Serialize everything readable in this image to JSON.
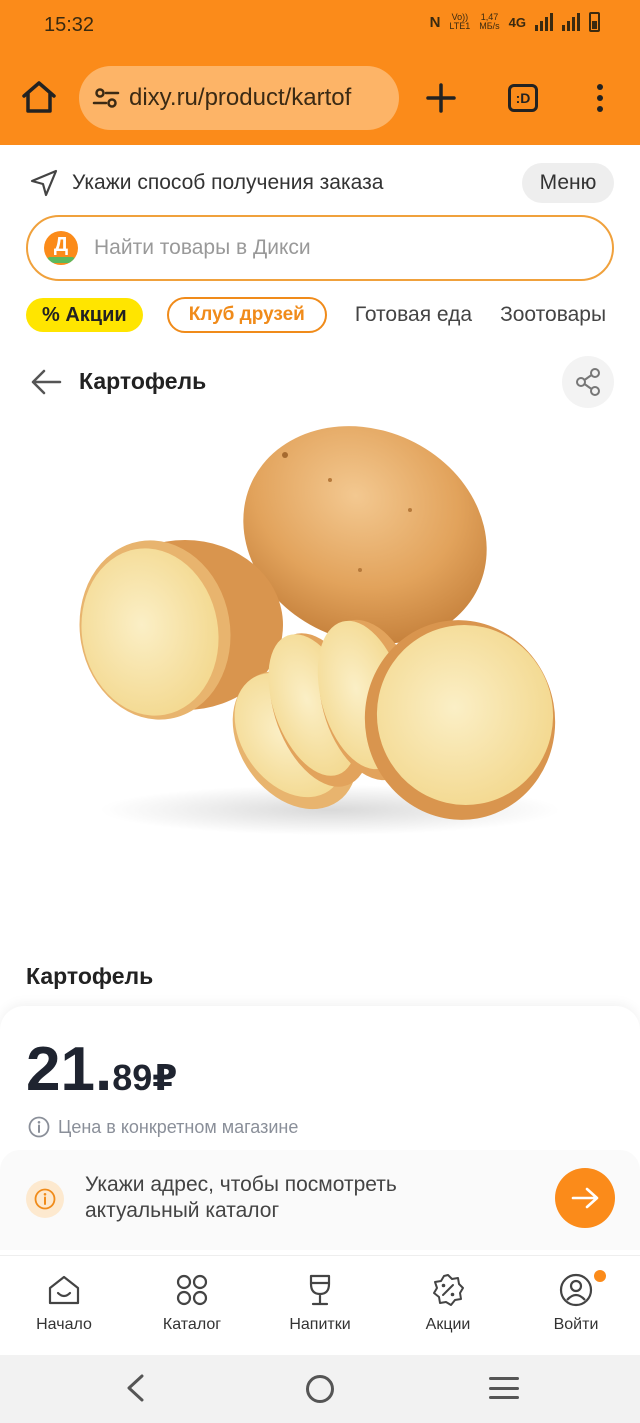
{
  "status_bar": {
    "time": "15:32",
    "nfc": "N",
    "volte": "Vo))",
    "lte": "LTE1",
    "speed_value": "1,47",
    "speed_unit": "MБ/s",
    "network": "4G"
  },
  "browser": {
    "url": "dixy.ru/product/kartof",
    "tabs_label": ":D"
  },
  "header": {
    "delivery_prompt": "Укажи способ получения заказа",
    "menu_label": "Меню",
    "search_placeholder": "Найти товары в Дикси",
    "logo_letter": "Д",
    "chips": {
      "promo": "% Акции",
      "club": "Клуб друзей",
      "ready_food": "Готовая еда",
      "zoo": "Зоотовары"
    }
  },
  "page": {
    "title": "Картофель"
  },
  "product": {
    "name": "Картофель",
    "price_int": "21",
    "price_sep": ".",
    "price_frac": "89",
    "currency": "₽",
    "price_note": "Цена в конкретном магазине"
  },
  "address_banner": {
    "text": "Укажи адрес, чтобы посмотреть актуальный каталог"
  },
  "tabbar": {
    "home": "Начало",
    "catalog": "Каталог",
    "drinks": "Напитки",
    "promos": "Акции",
    "login": "Войти"
  },
  "colors": {
    "brand_orange": "#fb8b1a",
    "promo_yellow": "#ffe500",
    "price_text": "#1f2430"
  }
}
